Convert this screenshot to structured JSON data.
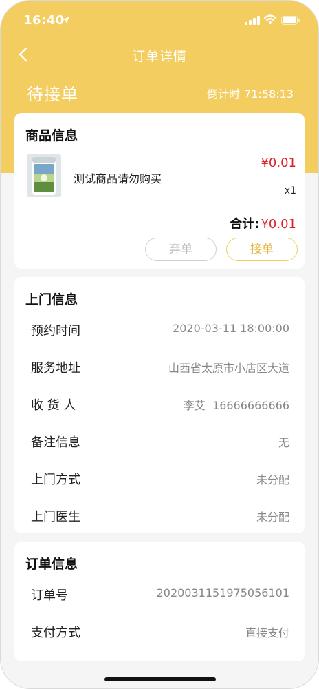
{
  "status_bar": {
    "time": "16:40"
  },
  "nav": {
    "title": "订单详情"
  },
  "order": {
    "status": "待接单",
    "countdown_label": "倒计时",
    "countdown_value": "71:58:13"
  },
  "product_section": {
    "title": "商品信息",
    "product_name": "测试商品请勿购买",
    "price": "¥0.01",
    "qty": "x1",
    "total_label": "合计:",
    "total_value": "¥0.01",
    "reject_label": "弃单",
    "accept_label": "接单"
  },
  "visit_section": {
    "title": "上门信息",
    "rows": [
      {
        "label": "预约时间",
        "value": "2020-03-11 18:00:00"
      },
      {
        "label": "服务地址",
        "value": "山西省太原市小店区大道"
      },
      {
        "label": "收 货 人",
        "value": "李艾  16666666666"
      },
      {
        "label": "备注信息",
        "value": "无"
      },
      {
        "label": "上门方式",
        "value": "未分配"
      },
      {
        "label": "上门医生",
        "value": "未分配"
      }
    ]
  },
  "order_section": {
    "title": "订单信息",
    "rows": [
      {
        "label": "订单号",
        "value": "2020031151975056101"
      },
      {
        "label": "支付方式",
        "value": "直接支付"
      }
    ]
  },
  "colors": {
    "brand": "#f3cd5f",
    "price_red": "#d9232b",
    "accept_text": "#e5b43c"
  }
}
